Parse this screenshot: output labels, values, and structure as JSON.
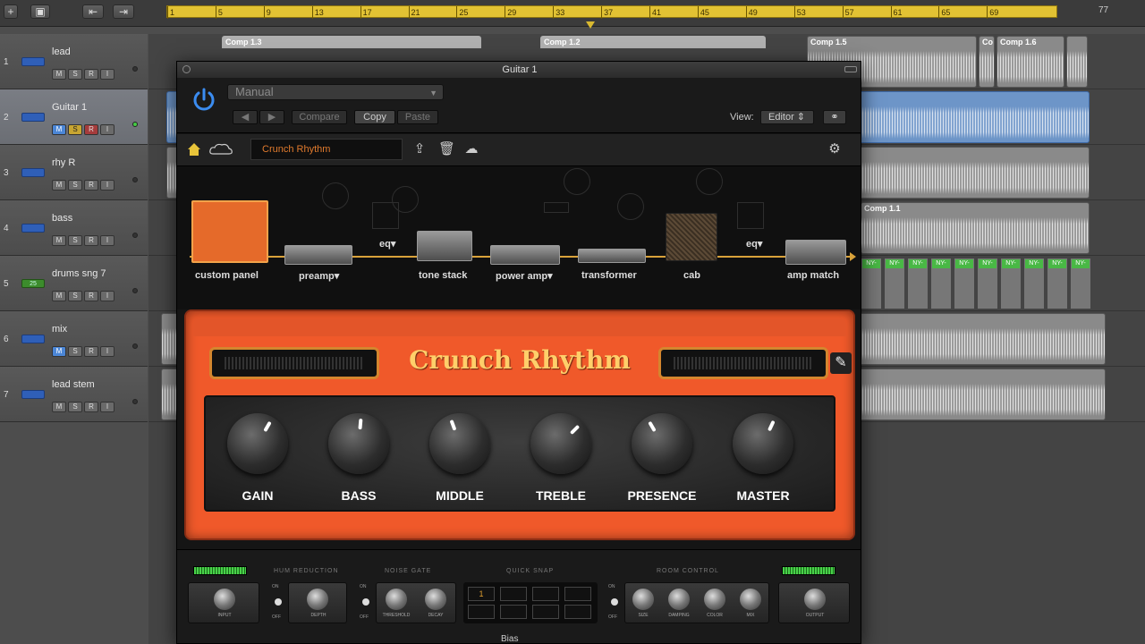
{
  "daw": {
    "ruler": {
      "ticks": [
        "1",
        "5",
        "9",
        "13",
        "17",
        "21",
        "25",
        "29",
        "33",
        "37",
        "41",
        "45",
        "49",
        "53",
        "57",
        "61",
        "65",
        "69"
      ],
      "end_label": "77"
    },
    "tracks": [
      {
        "num": "1",
        "name": "lead",
        "m": "M",
        "s": "S",
        "r": "R",
        "i": "I"
      },
      {
        "num": "2",
        "name": "Guitar 1",
        "m": "M",
        "s": "S",
        "r": "R",
        "i": "I"
      },
      {
        "num": "3",
        "name": "rhy R",
        "m": "M",
        "s": "S",
        "r": "R",
        "i": "I"
      },
      {
        "num": "4",
        "name": "bass",
        "m": "M",
        "s": "S",
        "r": "R",
        "i": "I"
      },
      {
        "num": "5",
        "name": "drums sng 7",
        "m": "M",
        "s": "S",
        "r": "R",
        "i": "I",
        "icon_text": "25"
      },
      {
        "num": "6",
        "name": "mix",
        "m": "M",
        "s": "S",
        "r": "R",
        "i": "I"
      },
      {
        "num": "7",
        "name": "lead stem",
        "m": "M",
        "s": "S",
        "r": "R",
        "i": "I"
      }
    ],
    "regions": {
      "comp_1_3": "Comp 1.3",
      "comp_1_2": "Comp 1.2",
      "comp_1_5": "Comp 1.5",
      "comp_1_6a": "Co",
      "comp_1_6": "Comp 1.6",
      "comp_1_1": "Comp 1.1",
      "drum_cell": "NY-"
    }
  },
  "plugin": {
    "window_title": "Guitar 1",
    "preset_mode": "Manual",
    "buttons": {
      "prev": "◀",
      "next": "▶",
      "compare": "Compare",
      "copy": "Copy",
      "paste": "Paste"
    },
    "view_label": "View:",
    "view_value": "Editor",
    "preset_name": "Crunch Rhythm",
    "chain": [
      {
        "label": "custom panel"
      },
      {
        "label": "preamp▾"
      },
      {
        "label": "tone stack"
      },
      {
        "label": "power amp▾"
      },
      {
        "label": "transformer"
      },
      {
        "label": "cab"
      },
      {
        "label": "amp match"
      }
    ],
    "eq_labels": [
      "eq▾",
      "eq▾"
    ],
    "amp_title": "Crunch Rhythm",
    "knobs": [
      {
        "label": "GAIN",
        "angle": 30
      },
      {
        "label": "BASS",
        "angle": 5
      },
      {
        "label": "MIDDLE",
        "angle": -20
      },
      {
        "label": "TREBLE",
        "angle": 45
      },
      {
        "label": "PRESENCE",
        "angle": -30
      },
      {
        "label": "MASTER",
        "angle": 25
      }
    ],
    "bottom": {
      "sections": [
        "HUM REDUCTION",
        "NOISE GATE",
        "QUICK SNAP",
        "ROOM CONTROL"
      ],
      "knob_labels": {
        "input": "INPUT",
        "depth": "DEPTH",
        "threshold": "THRESHOLD",
        "decay": "DECAY",
        "size": "SIZE",
        "damping": "DAMPING",
        "color": "COLOR",
        "mix": "MIX",
        "output": "OUTPUT"
      },
      "switch_on": "ON",
      "switch_off": "OFF",
      "quick_snap_active": "1",
      "bias_label": "Bias"
    }
  }
}
